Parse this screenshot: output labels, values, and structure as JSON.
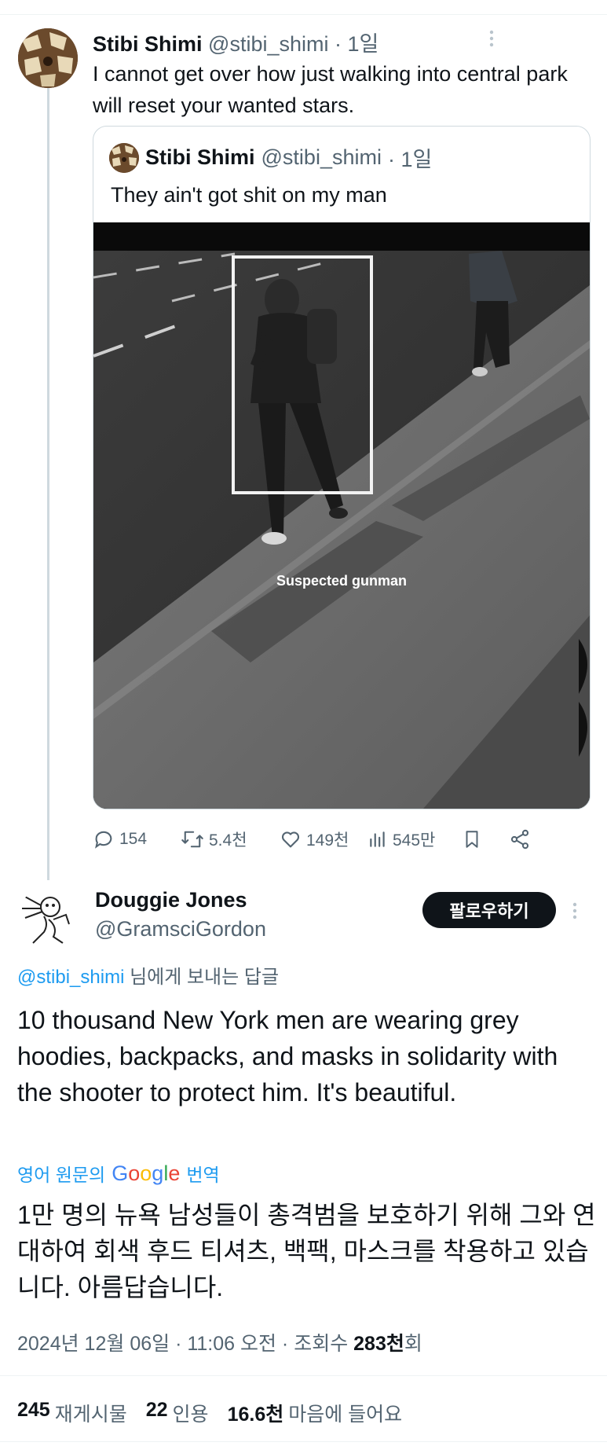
{
  "tweet1": {
    "author_name": "Stibi Shimi",
    "handle": "@stibi_shimi",
    "time": "· 1일",
    "text": "I cannot get over how just walking into central park will reset your wanted stars."
  },
  "quote": {
    "author_name": "Stibi Shimi",
    "handle": "@stibi_shimi",
    "time": "· 1일",
    "text": "They ain't got shit on my man",
    "video_label": "Suspected gunman"
  },
  "actions": {
    "replies": "154",
    "retweets": "5.4천",
    "likes": "149천",
    "views": "545만"
  },
  "reply": {
    "author_name": "Douggie Jones",
    "handle": "@GramsciGordon",
    "follow_label": "팔로우하기",
    "replying_to_handle": "@stibi_shimi",
    "replying_to_suffix": " 님에게 보내는 답글",
    "text": "10 thousand New York men are wearing grey hoodies, backpacks, and masks in solidarity with the shooter to protect him. It's beautiful.",
    "translate_prefix": "영어 원문의",
    "translate_brand": "Google",
    "translate_suffix": "번역",
    "translated_text": "1만 명의 뉴욕 남성들이 총격범을 보호하기 위해 그와 연대하여 회색 후드 티셔츠, 백팩, 마스크를 착용하고 있습니다. 아름답습니다.",
    "timestamp": "2024년 12월 06일 · 11:06 오전 · 조회수 ",
    "views_count": "283천",
    "views_suffix": "회"
  },
  "stats": {
    "reposts_count": "245",
    "reposts_label": "재게시물",
    "quotes_count": "22",
    "quotes_label": "인용",
    "likes_count": "16.6천",
    "likes_label": "마음에 들어요"
  },
  "colors": {
    "link_blue": "#1d9bf0",
    "muted_gray": "#536471",
    "text_black": "#0f1419"
  }
}
